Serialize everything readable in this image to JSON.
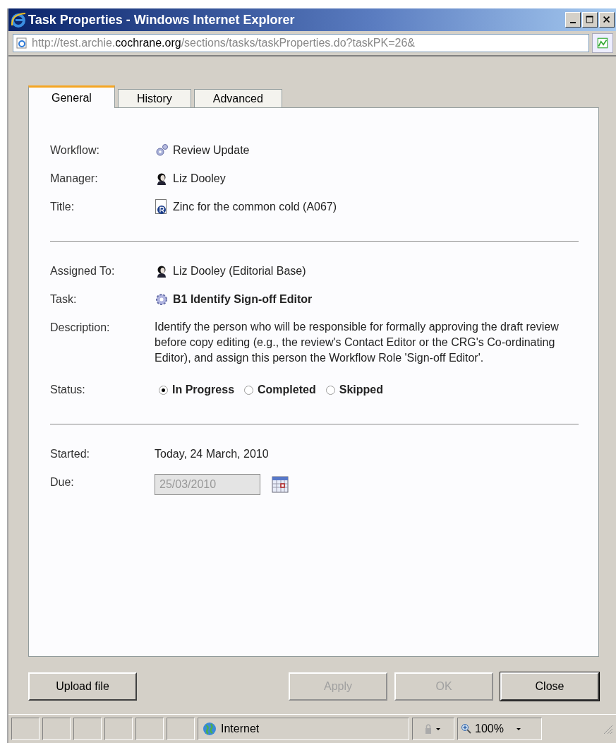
{
  "window": {
    "title": "Task Properties - Windows Internet Explorer"
  },
  "address_bar": {
    "url_prefix": "http://test.archie.",
    "url_domain": "cochrane.org",
    "url_suffix": "/sections/tasks/taskProperties.do?taskPK=26&"
  },
  "tabs": [
    {
      "label": "General",
      "selected": true
    },
    {
      "label": "History",
      "selected": false
    },
    {
      "label": "Advanced",
      "selected": false
    }
  ],
  "sections": [
    {
      "rows": [
        {
          "kind": "workflow",
          "label": "Workflow:",
          "value": "Review Update"
        },
        {
          "kind": "person",
          "label": "Manager:",
          "value": "Liz Dooley"
        },
        {
          "kind": "review",
          "label": "Title:",
          "value": "Zinc for the common cold (A067)"
        }
      ]
    },
    {
      "rows": [
        {
          "kind": "person",
          "label": "Assigned To:",
          "value": "Liz Dooley (Editorial Base)"
        },
        {
          "kind": "task",
          "label": "Task:",
          "value": "B1 Identify Sign-off Editor"
        },
        {
          "kind": "text",
          "label": "Description:",
          "value": "Identify the person who will be responsible for formally approving the draft review before copy editing (e.g., the review's Contact Editor or the CRG's Co-ordinating Editor), and assign this person the Workflow Role 'Sign-off Editor'."
        },
        {
          "kind": "status",
          "label": "Status:",
          "options": [
            {
              "label": "In Progress",
              "selected": true
            },
            {
              "label": "Completed",
              "selected": false
            },
            {
              "label": "Skipped",
              "selected": false
            }
          ]
        }
      ]
    },
    {
      "rows": [
        {
          "kind": "plain",
          "label": "Started:",
          "value": "Today, 24 March, 2010"
        },
        {
          "kind": "date",
          "label": "Due:",
          "value": "25/03/2010",
          "disabled": true
        }
      ]
    }
  ],
  "buttons": [
    {
      "label": "Upload file",
      "disabled": false,
      "default": false
    },
    {
      "label": "Apply",
      "disabled": true,
      "default": false
    },
    {
      "label": "OK",
      "disabled": true,
      "default": false
    },
    {
      "label": "Close",
      "disabled": false,
      "default": true
    }
  ],
  "status_bar": {
    "zone": "Internet",
    "zoom": "100%"
  }
}
